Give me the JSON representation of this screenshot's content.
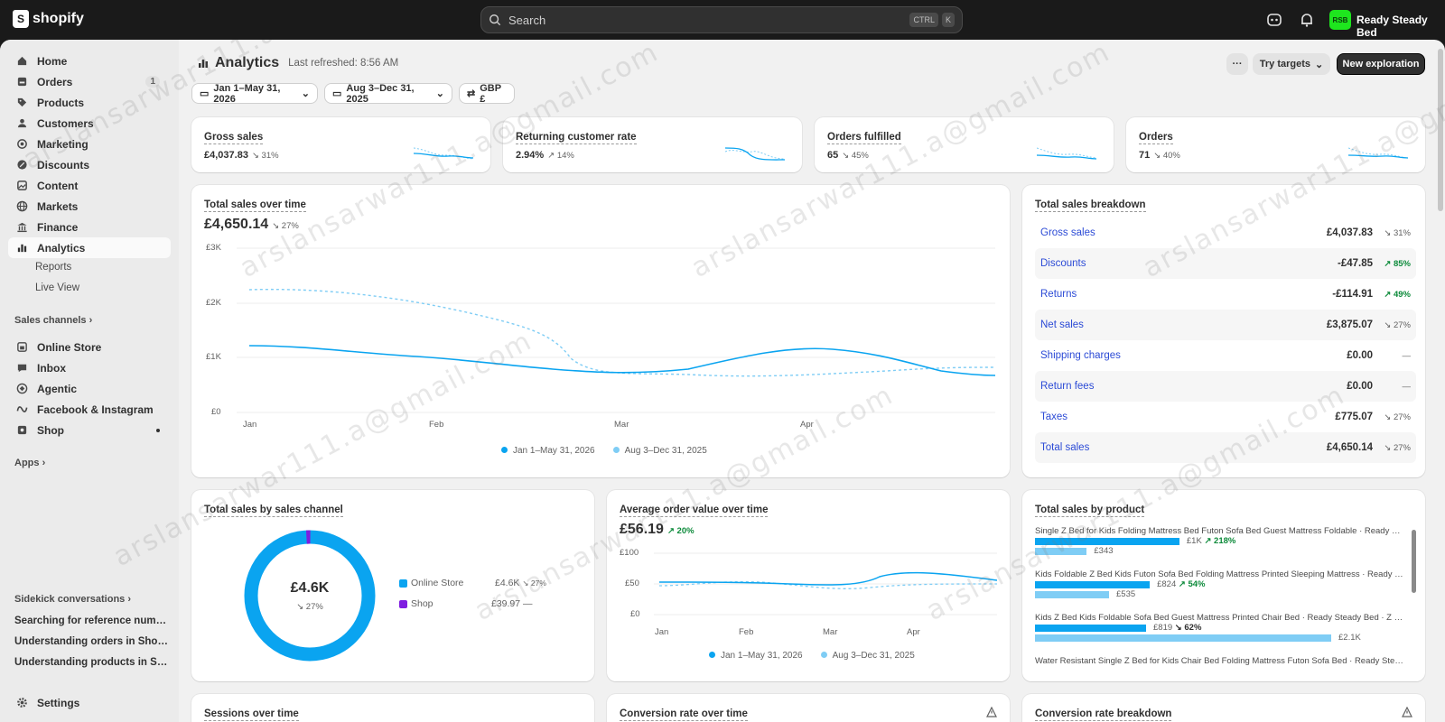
{
  "topbar": {
    "brand": "shopify",
    "search_placeholder": "Search",
    "shortcut_key1": "CTRL",
    "shortcut_key2": "K",
    "store_initials": "RSB",
    "store_name": "Ready Steady Bed"
  },
  "sidebar": {
    "items": [
      {
        "label": "Home"
      },
      {
        "label": "Orders",
        "badge": "1"
      },
      {
        "label": "Products"
      },
      {
        "label": "Customers"
      },
      {
        "label": "Marketing"
      },
      {
        "label": "Discounts"
      },
      {
        "label": "Content"
      },
      {
        "label": "Markets"
      },
      {
        "label": "Finance"
      },
      {
        "label": "Analytics"
      }
    ],
    "analytics_sub": [
      "Reports",
      "Live View"
    ],
    "sales_channels_title": "Sales channels",
    "channels": [
      "Online Store",
      "Inbox",
      "Agentic",
      "Facebook & Instagram",
      "Shop"
    ],
    "apps_title": "Apps",
    "sidekick_title": "Sidekick conversations",
    "sidekick_items": [
      "Searching for reference numb...",
      "Understanding orders in Shopify",
      "Understanding products in Sh..."
    ],
    "settings": "Settings"
  },
  "header": {
    "title": "Analytics",
    "last_refreshed": "Last refreshed: 8:56 AM",
    "more": "···",
    "try_targets": "Try targets",
    "new_exploration": "New exploration"
  },
  "filters": {
    "date_range": "Jan 1–May 31, 2026",
    "compare_range": "Aug 3–Dec 31, 2025",
    "currency": "GBP £"
  },
  "kpis": [
    {
      "title": "Gross sales",
      "value": "£4,037.83",
      "change": "31%"
    },
    {
      "title": "Returning customer rate",
      "value": "2.94%",
      "change": "14%"
    },
    {
      "title": "Orders fulfilled",
      "value": "65",
      "change": "45%"
    },
    {
      "title": "Orders",
      "value": "71",
      "change": "40%"
    }
  ],
  "sales_over_time": {
    "title": "Total sales over time",
    "value": "£4,650.14",
    "change": "27%",
    "y_ticks": [
      "£3K",
      "£2K",
      "£1K",
      "£0"
    ],
    "x_ticks": [
      "Jan",
      "Feb",
      "Mar",
      "Apr"
    ],
    "legend": [
      "Jan 1–May 31, 2026",
      "Aug 3–Dec 31, 2025"
    ]
  },
  "breakdown": {
    "title": "Total sales breakdown",
    "rows": [
      {
        "label": "Gross sales",
        "value": "£4,037.83",
        "change": "31%"
      },
      {
        "label": "Discounts",
        "value": "-£47.85",
        "change": "85%"
      },
      {
        "label": "Returns",
        "value": "-£114.91",
        "change": "49%"
      },
      {
        "label": "Net sales",
        "value": "£3,875.07",
        "change": "27%"
      },
      {
        "label": "Shipping charges",
        "value": "£0.00",
        "change": "—"
      },
      {
        "label": "Return fees",
        "value": "£0.00",
        "change": "—"
      },
      {
        "label": "Taxes",
        "value": "£775.07",
        "change": "27%"
      },
      {
        "label": "Total sales",
        "value": "£4,650.14",
        "change": "27%"
      }
    ]
  },
  "by_channel": {
    "title": "Total sales by sales channel",
    "center_value": "£4.6K",
    "center_change": "27%",
    "channels": [
      {
        "name": "Online Store",
        "value": "£4.6K",
        "change": "27%",
        "color": "#0aa4f0"
      },
      {
        "name": "Shop",
        "value": "£39.97",
        "change": "—",
        "color": "#7f1de0"
      }
    ]
  },
  "aov": {
    "title": "Average order value over time",
    "value": "£56.19",
    "change": "20%",
    "y_ticks": [
      "£100",
      "£50",
      "£0"
    ],
    "x_ticks": [
      "Jan",
      "Feb",
      "Mar",
      "Apr"
    ],
    "legend": [
      "Jan 1–May 31, 2026",
      "Aug 3–Dec 31, 2025"
    ]
  },
  "by_product": {
    "title": "Total sales by product",
    "products": [
      {
        "name": "Single Z Bed for Kids Folding Mattress Bed Futon Sofa Bed Guest Mattress Foldable · Ready St...",
        "current": "£1K",
        "current_frac": 0.39,
        "previous": "£343",
        "previous_frac": 0.14,
        "change": "218%"
      },
      {
        "name": "Kids Foldable Z Bed Kids Futon Sofa Bed Folding Mattress Printed Sleeping Mattress · Ready S...",
        "current": "£824",
        "current_frac": 0.31,
        "previous": "£535",
        "previous_frac": 0.2,
        "change": "54%"
      },
      {
        "name": "Kids Z Bed Kids Foldable Sofa Bed Guest Mattress Printed Chair Bed · Ready Steady Bed · Z Bed",
        "current": "£819",
        "current_frac": 0.3,
        "previous": "£2.1K",
        "previous_frac": 0.8,
        "change": "62%"
      },
      {
        "name": "Water Resistant Single Z Bed for Kids Chair Bed Folding Mattress Futon Sofa Bed · Ready Stea..."
      }
    ]
  },
  "bottom_cards": [
    "Sessions over time",
    "Conversion rate over time",
    "Conversion rate breakdown"
  ],
  "watermark": "arslansarwar111.a@gmail.com",
  "colors": {
    "primary_line": "#0aa4f0",
    "compare_line": "#7fcdf5",
    "shop_purple": "#7f1de0"
  }
}
